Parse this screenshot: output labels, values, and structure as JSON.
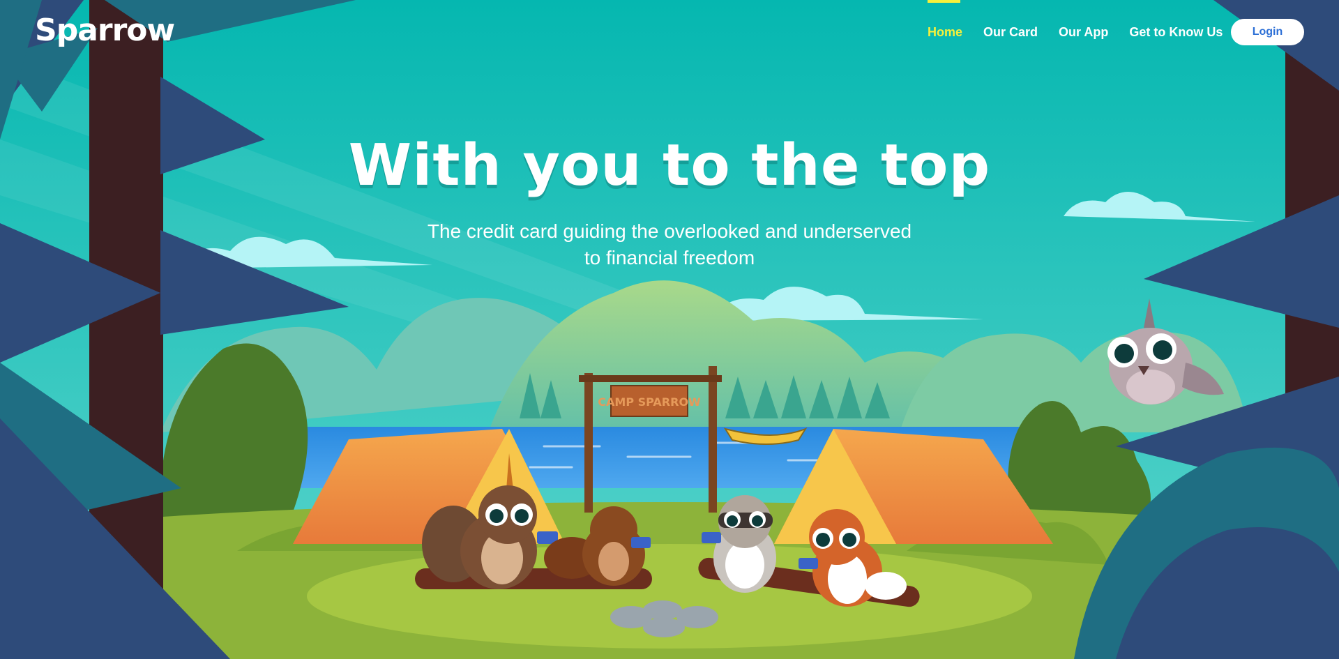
{
  "brand": {
    "logo_text": "Sparrow"
  },
  "nav": {
    "items": [
      {
        "label": "Home",
        "active": true
      },
      {
        "label": "Our Card",
        "active": false
      },
      {
        "label": "Our App",
        "active": false
      },
      {
        "label": "Get to Know Us",
        "active": false
      }
    ],
    "login_label": "Login"
  },
  "hero": {
    "title": "With you to the top",
    "subtitle": "The credit card guiding the overlooked and underserved to financial freedom"
  },
  "scene": {
    "sign_text": "CAMP SPARROW"
  },
  "colors": {
    "sky": "#06b9b2",
    "active_nav": "#f6f03b",
    "login_text": "#2c6fd6",
    "tree_dark": "#2e4b7a",
    "grass": "#8db33a"
  },
  "icons": [
    "login-button",
    "campfire-icon"
  ]
}
